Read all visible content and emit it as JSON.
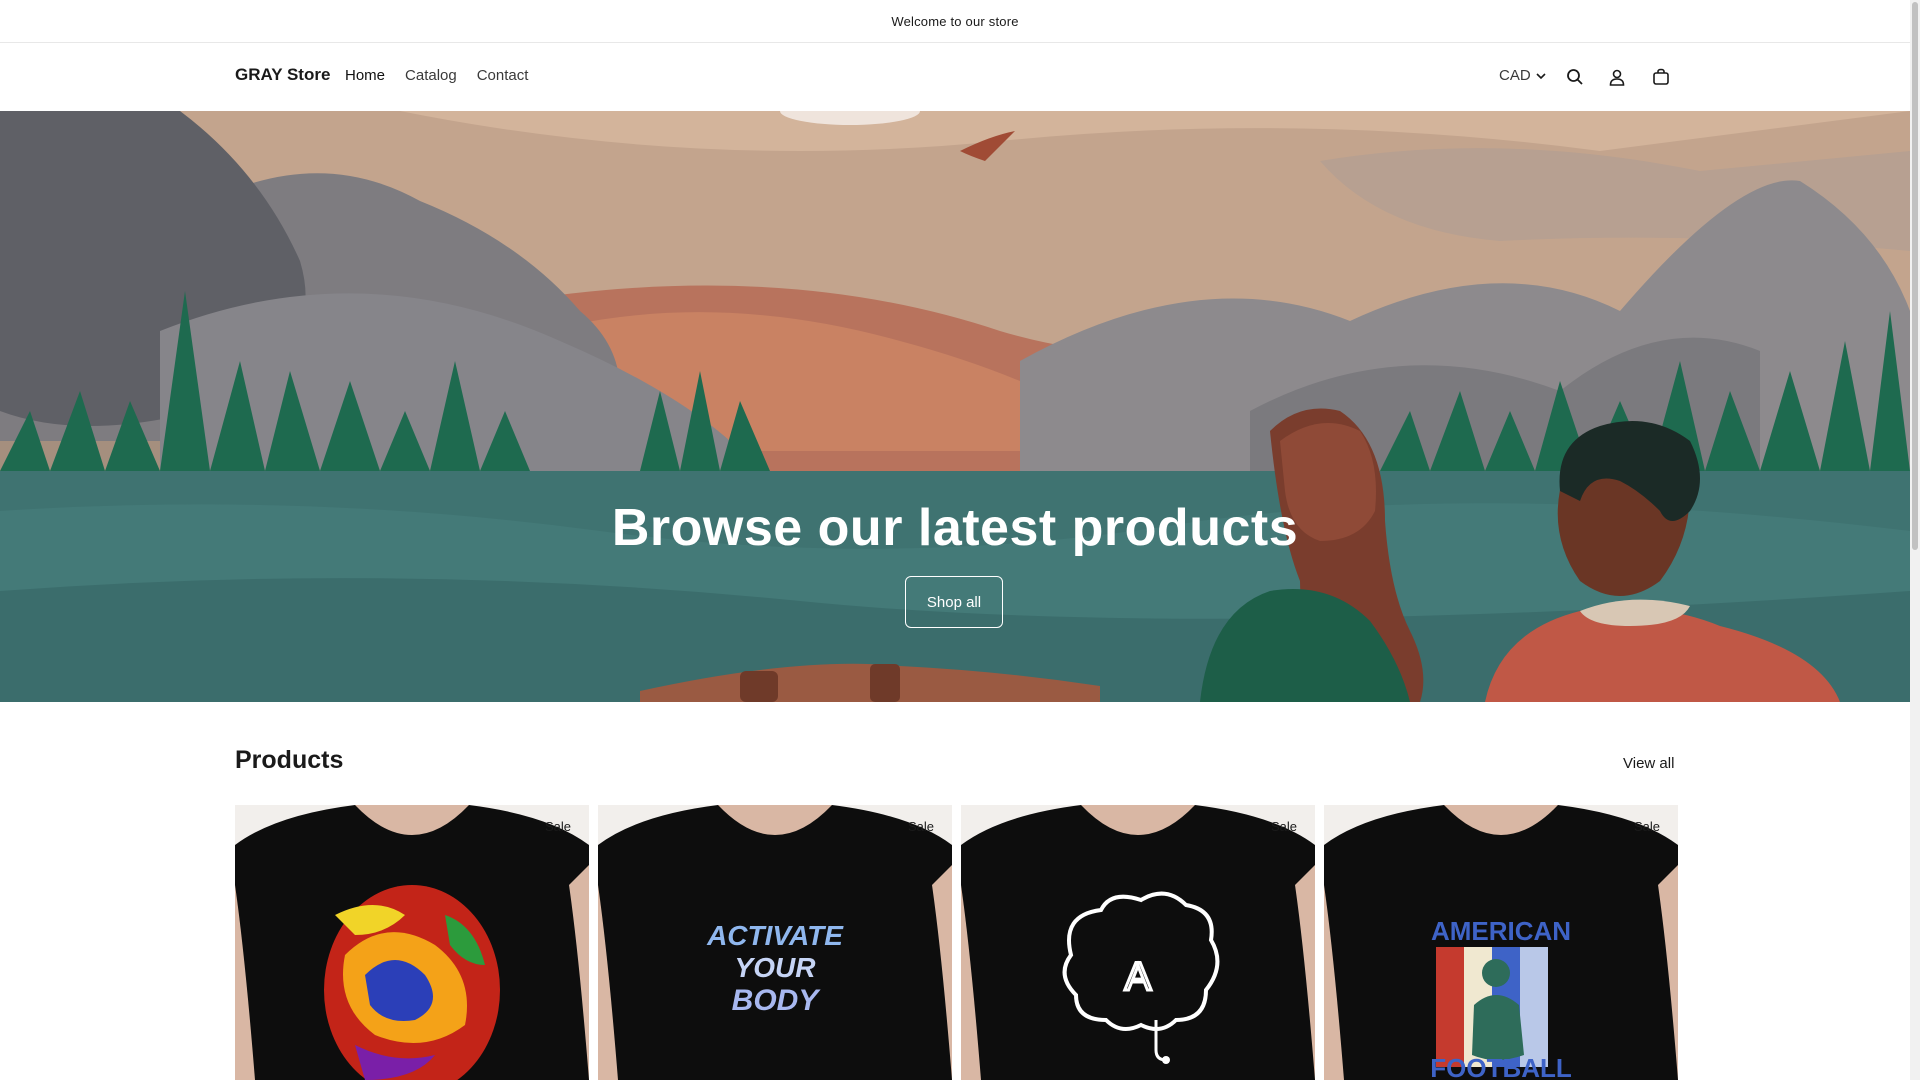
{
  "announcement": "Welcome to our store",
  "header": {
    "brand": "GRAY Store",
    "nav": [
      "Home",
      "Catalog",
      "Contact"
    ],
    "currency": "CAD",
    "icons": [
      "search-icon",
      "account-icon",
      "cart-icon"
    ]
  },
  "hero": {
    "title": "Browse our latest products",
    "button": "Shop all"
  },
  "products": {
    "title": "Products",
    "view_all": "View all",
    "items": [
      {
        "badge": "Sale",
        "design": "psychedelic-egg"
      },
      {
        "badge": "Sale",
        "design": "activate-your-body"
      },
      {
        "badge": "Sale",
        "design": "ai-brain"
      },
      {
        "badge": "Sale",
        "design": "american-football"
      }
    ],
    "print_text": {
      "activate": [
        "ACTIVATE",
        "YOUR",
        "BODY"
      ],
      "football": [
        "AMERICAN",
        "FOOTBALL"
      ],
      "brain_letter": "A"
    }
  },
  "colors": {
    "teal": "#3f7371",
    "forest": "#1e6a4f",
    "terracotta": "#c36a4e"
  }
}
